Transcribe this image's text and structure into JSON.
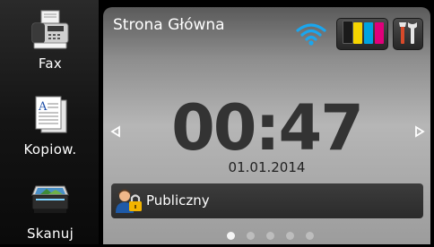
{
  "sidebar": {
    "items": [
      {
        "label": "Fax",
        "icon": "fax-icon"
      },
      {
        "label": "Kopiow.",
        "icon": "copy-document-icon"
      },
      {
        "label": "Skanuj",
        "icon": "scanner-icon"
      }
    ]
  },
  "header": {
    "title": "Strona Główna",
    "wifi_icon": "wifi-icon",
    "ink_icon": "ink-cartridges-icon",
    "tools_icon": "tools-icon"
  },
  "ink_colors": [
    "#1a1a1a",
    "#f5d400",
    "#00a3e0",
    "#e0007a"
  ],
  "clock": {
    "time": "00:47",
    "date": "01.01.2014"
  },
  "user": {
    "label": "Publiczny",
    "icon": "public-user-lock-icon"
  },
  "navigation": {
    "prev_icon": "arrow-left-icon",
    "next_icon": "arrow-right-icon"
  },
  "pager": {
    "pages": 5,
    "current": 1
  },
  "colors": {
    "panel_top": "#5a5a5a",
    "panel_bottom": "#9c9c9c",
    "clock_text": "#333333",
    "wifi": "#1aa6ee"
  }
}
